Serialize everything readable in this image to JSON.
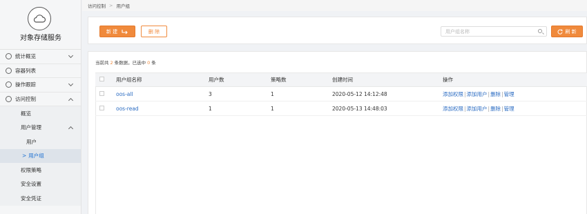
{
  "app": {
    "title": "对象存储服务"
  },
  "sidebar": {
    "items": [
      {
        "label": "统计概览",
        "expanded": false
      },
      {
        "label": "容器列表"
      },
      {
        "label": "操作跟踪",
        "expanded": false
      },
      {
        "label": "访问控制",
        "expanded": true
      }
    ],
    "sub_items": [
      {
        "label": "概览"
      },
      {
        "label": "用户管理",
        "expanded": true
      },
      {
        "label": "用户"
      },
      {
        "label": "用户组",
        "active": true
      },
      {
        "label": "权限策略"
      },
      {
        "label": "安全设置"
      },
      {
        "label": "安全凭证"
      }
    ],
    "active_marker": ">"
  },
  "breadcrumb": {
    "parent": "访问控制",
    "separator": ">",
    "current": "用户组"
  },
  "toolbar": {
    "new_label": "新 建",
    "delete_label": "删 除",
    "search_placeholder": "用户组名称",
    "refresh_label": "刷 新"
  },
  "summary": {
    "prefix": "当前共",
    "total": "2",
    "mid": "条数据，已选中",
    "selected": "0",
    "suffix": "条"
  },
  "table": {
    "headers": [
      "用户组名称",
      "用户数",
      "策略数",
      "创建时间",
      "操作"
    ],
    "rows": [
      {
        "name": "oos-all",
        "users": "3",
        "policies": "1",
        "created": "2020-05-12 14:12:48"
      },
      {
        "name": "oos-read",
        "users": "1",
        "policies": "1",
        "created": "2020-05-13 14:48:03"
      }
    ],
    "actions": [
      "添加权限",
      "添加用户",
      "删除",
      "管理"
    ],
    "action_separator": "|"
  },
  "colors": {
    "accent": "#f08a3c",
    "link": "#2a6bc2",
    "active_nav": "#1a6fd1"
  }
}
